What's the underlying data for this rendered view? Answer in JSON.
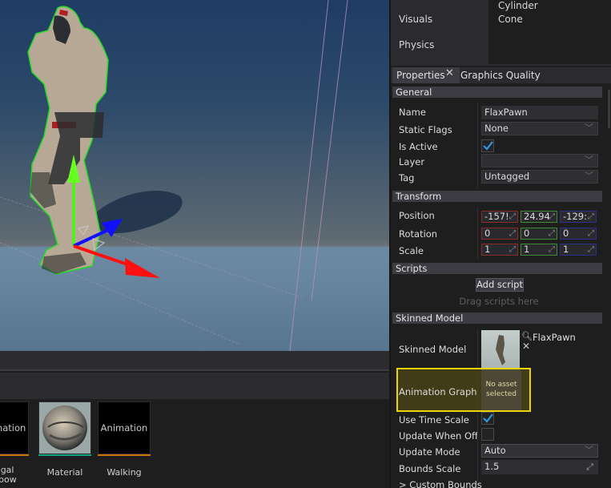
{
  "toolbox": {
    "categories": [
      "Visuals",
      "Physics"
    ],
    "items": [
      "Cylinder",
      "Cone"
    ]
  },
  "tabs": [
    {
      "label": "Properties",
      "active": true
    },
    {
      "label": "Graphics Quality",
      "active": false
    }
  ],
  "tab_close_glyph": "✕",
  "properties": {
    "general": {
      "header": "General",
      "name_label": "Name",
      "name_value": "FlaxPawn",
      "static_flags_label": "Static Flags",
      "static_flags_value": "None",
      "is_active_label": "Is Active",
      "is_active_checked": true,
      "layer_label": "Layer",
      "layer_value": "",
      "tag_label": "Tag",
      "tag_value": "Untagged"
    },
    "transform": {
      "header": "Transform",
      "position_label": "Position",
      "position": [
        "-157!",
        "24.94",
        "-129:"
      ],
      "rotation_label": "Rotation",
      "rotation": [
        "0",
        "0",
        "0"
      ],
      "scale_label": "Scale",
      "scale": [
        "1",
        "1",
        "1"
      ]
    },
    "scripts": {
      "header": "Scripts",
      "add_button": "Add script",
      "drag_hint": "Drag scripts here"
    },
    "skinned_model": {
      "header": "Skinned Model",
      "model_label": "Skinned Model",
      "model_asset": "FlaxPawn",
      "anim_graph_label": "Animation Graph",
      "anim_graph_value": "No asset selected",
      "use_time_scale_label": "Use Time Scale",
      "use_time_scale_checked": true,
      "update_offscreen_label": "Update When Offs",
      "update_offscreen_checked": false,
      "update_mode_label": "Update Mode",
      "update_mode_value": "Auto",
      "bounds_scale_label": "Bounds Scale",
      "bounds_scale_value": "1.5",
      "custom_bounds_label": "> Custom Bounds"
    }
  },
  "assets": [
    {
      "thumb_text": "Animation",
      "label_lines": [
        "Legal",
        "Elbow"
      ],
      "type_color": "#c87800"
    },
    {
      "thumb_text": "",
      "label_lines": [
        "Material"
      ],
      "type_color": "#10a37f"
    },
    {
      "thumb_text": "Animation",
      "label_lines": [
        "Walking"
      ],
      "type_color": "#c87800"
    }
  ],
  "highlight_color": "#f0d400"
}
